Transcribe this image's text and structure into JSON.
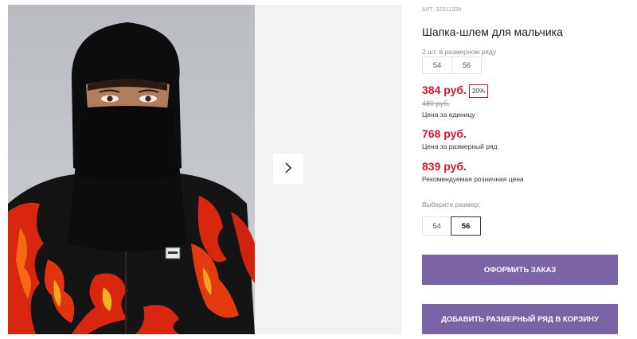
{
  "product": {
    "article": "АРТ. 32311336",
    "title": "Шапка-шлем для мальчика"
  },
  "range": {
    "label": "2 шт. в размерном ряду",
    "sizes": [
      "54",
      "56"
    ]
  },
  "prices": {
    "unit_price": "384 руб.",
    "discount": "20%",
    "old_price": "480 руб.",
    "unit_caption": "Цена за единицу",
    "range_price": "768 руб.",
    "range_caption": "Цена за размерный ряд",
    "retail_price": "839 руб.",
    "retail_caption": "Рекомендуемая розничная цена"
  },
  "size_select": {
    "label": "Выберите размер:",
    "options": [
      "54",
      "56"
    ],
    "selected": "56"
  },
  "actions": {
    "order_label": "ОФОРМИТЬ ЗАКАЗ",
    "add_range_label": "ДОБАВИТЬ РАЗМЕРНЫЙ РЯД В КОРЗИНУ"
  },
  "colors": {
    "price_red": "#d7172f",
    "button_purple": "#7b64a5"
  },
  "icons": {
    "next": "chevron-right-icon"
  }
}
